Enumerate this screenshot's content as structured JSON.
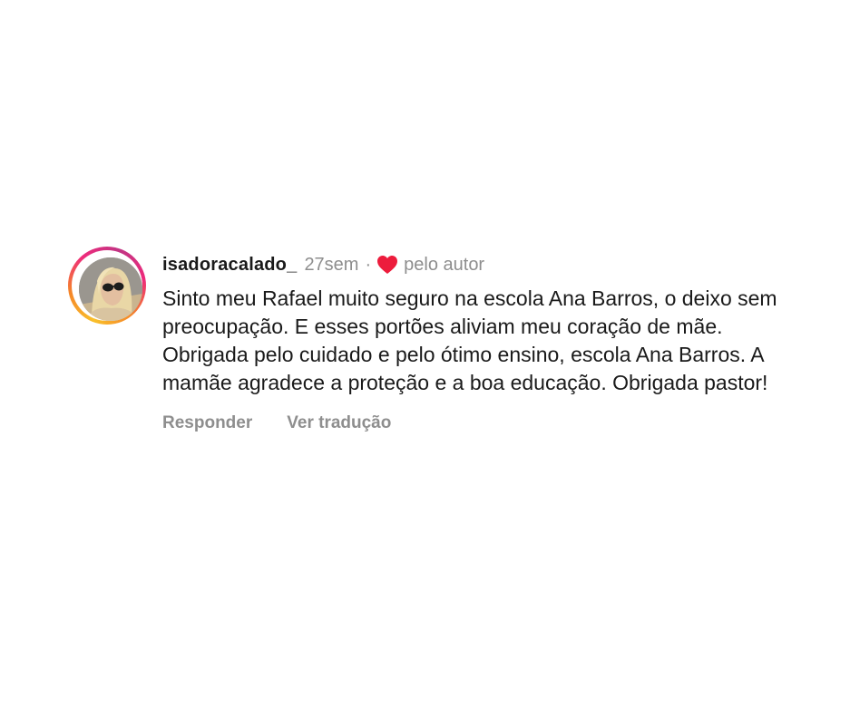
{
  "comment": {
    "username": "isadoracalado_",
    "time": "27sem",
    "separator": "·",
    "liked_by_author_label": "pelo autor",
    "text": "Sinto meu Rafael muito seguro na escola Ana Barros, o deixo sem preocupação. E esses portões aliviam meu coração de mãe. Obrigada pelo cuidado e pelo ótimo ensino, escola Ana Barros. A mamãe agradece a proteção e a boa educação. Obrigada pastor!",
    "reply_label": "Responder",
    "translate_label": "Ver tradução"
  },
  "colors": {
    "primary_text": "#1a1a1a",
    "secondary_text": "#8e8e8e",
    "heart": "#ed1c3c",
    "story_ring": [
      "#f9c02b",
      "#f58529",
      "#ee2a7b",
      "#c13584"
    ]
  },
  "icons": {
    "liked": "heart-icon"
  }
}
